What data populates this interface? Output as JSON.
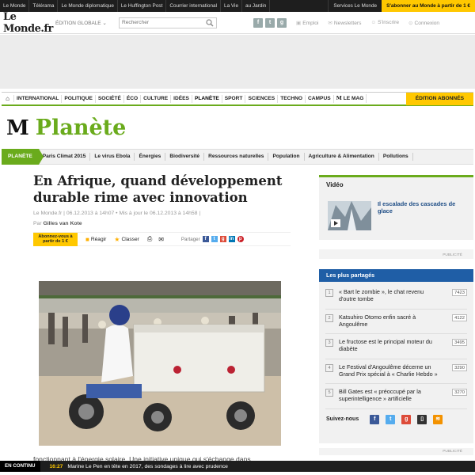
{
  "netbar": {
    "sites": [
      "Le Monde",
      "Télérama",
      "Le Monde diplomatique",
      "Le Huffington Post",
      "Courrier international",
      "La Vie",
      "au Jardin"
    ],
    "services": "Services Le Monde",
    "subscribe": "S'abonner au Monde à partir de 1 €"
  },
  "header": {
    "logo": "Le Monde.fr",
    "edition": "ÉDITION GLOBALE",
    "search_placeholder": "Rechercher",
    "links": {
      "emploi": "Emploi",
      "newsletters": "Newsletters",
      "inscrire": "S'inscrire",
      "connexion": "Connexion"
    }
  },
  "nav": {
    "items": [
      "INTERNATIONAL",
      "POLITIQUE",
      "SOCIÉTÉ",
      "ÉCO",
      "CULTURE",
      "IDÉES",
      "PLANÈTE",
      "SPORT",
      "SCIENCES",
      "TECHNO",
      "CAMPUS"
    ],
    "mag": "LE MAG",
    "mag_mark": "M",
    "subscribers": "ÉDITION ABONNÉS"
  },
  "section": {
    "mark": "M",
    "title": "Planète"
  },
  "subnav": {
    "current": "PLANÈTE",
    "items": [
      "Paris Climat 2015",
      "Le virus Ebola",
      "Énergies",
      "Biodiversité",
      "Ressources naturelles",
      "Population",
      "Agriculture & Alimentation",
      "Pollutions"
    ]
  },
  "article": {
    "headline": "En Afrique, quand développement durable rime avec innovation",
    "meta": "Le Monde.fr | 06.12.2013 à 14h07 • Mis à jour le 06.12.2013 à 14h58 |",
    "author_prefix": "Par",
    "author": "Gilles van Kote",
    "subscribe_label": "Abonnez-vous à partir de 1 €",
    "react": "Réagir",
    "classer": "Classer",
    "partager": "Partager",
    "body_start": "fonctionnant à l'énergie solaire. Une initiative unique qui s'échange dans"
  },
  "sidebar": {
    "video_heading": "Vidéo",
    "video_caption": "Il escalade des cascades de glace",
    "publicite": "PUBLICITÉ",
    "most_shared_heading": "Les plus partagés",
    "most_shared": [
      {
        "rank": "1",
        "title": "« Bart le zombie », le chat revenu d'outre tombe",
        "count": "7423"
      },
      {
        "rank": "2",
        "title": "Katsuhiro Otomo enfin sacré à Angoulême",
        "count": "4122"
      },
      {
        "rank": "3",
        "title": "Le fructose est le principal moteur du diabète",
        "count": "3495"
      },
      {
        "rank": "4",
        "title": "Le Festival d'Angoulême décerne un Grand Prix spécial à « Charlie Hebdo »",
        "count": "3290"
      },
      {
        "rank": "5",
        "title": "Bill Gates est « préoccupé par la superintelligence » artificielle",
        "count": "3270"
      }
    ],
    "follow_label": "Suivez-nous"
  },
  "ticker": {
    "label": "EN CONTINU",
    "time": "16:27",
    "text": "Marine Le Pen en tête en 2017, des sondages à lire avec prudence"
  }
}
